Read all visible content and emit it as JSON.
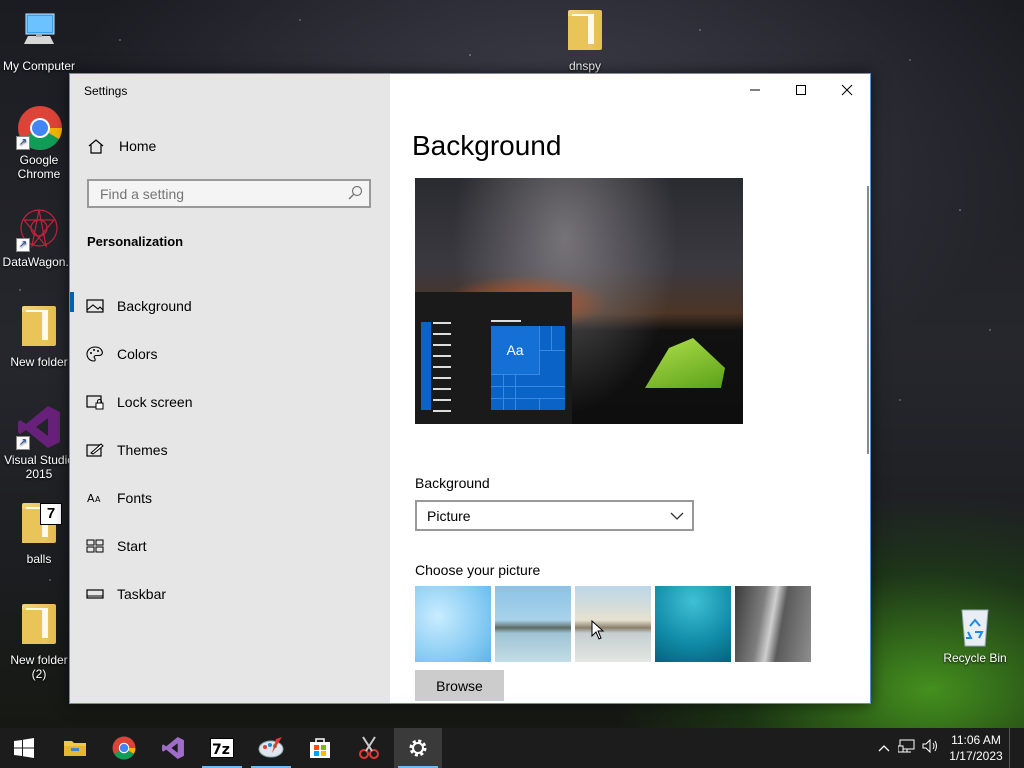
{
  "desktop": {
    "icons": [
      {
        "label": "My Computer"
      },
      {
        "label": "Google\nChrome"
      },
      {
        "label": "DataWagon..."
      },
      {
        "label": "New folder"
      },
      {
        "label": "Visual Studio\n2015"
      },
      {
        "label": "balls"
      },
      {
        "label": "New folder\n(2)"
      },
      {
        "label": "dnspy"
      },
      {
        "label": "Recycle Bin"
      }
    ]
  },
  "window": {
    "title": "Settings",
    "controls": {
      "minimize": "minimize",
      "maximize": "maximize",
      "close": "close"
    }
  },
  "sidebar": {
    "home_label": "Home",
    "search_placeholder": "Find a setting",
    "section_title": "Personalization",
    "items": [
      {
        "label": "Background",
        "icon": "picture-icon",
        "active": true
      },
      {
        "label": "Colors",
        "icon": "palette-icon"
      },
      {
        "label": "Lock screen",
        "icon": "lock-screen-icon"
      },
      {
        "label": "Themes",
        "icon": "themes-icon"
      },
      {
        "label": "Fonts",
        "icon": "fonts-icon"
      },
      {
        "label": "Start",
        "icon": "start-icon"
      },
      {
        "label": "Taskbar",
        "icon": "taskbar-icon"
      }
    ]
  },
  "main": {
    "heading": "Background",
    "preview": {
      "tile_text": "Aa"
    },
    "background_label": "Background",
    "background_value": "Picture",
    "choose_label": "Choose your picture",
    "thumbnails": [
      "light-blue-windows",
      "beach-rocks",
      "beach-rocks-bright",
      "underwater-swimmer",
      "rock-cliff"
    ],
    "browse_label": "Browse"
  },
  "taskbar": {
    "apps": [
      "start-button",
      "file-explorer",
      "google-chrome",
      "visual-studio",
      "7zip",
      "paint",
      "microsoft-store",
      "snipping-tool",
      "settings"
    ],
    "time": "11:06 AM",
    "date": "1/17/2023"
  },
  "colors": {
    "accent": "#0063b1",
    "tile_blue": "#0a63c6",
    "taskbar": "#1c1c1c",
    "sidebar": "#e6e6e6"
  }
}
